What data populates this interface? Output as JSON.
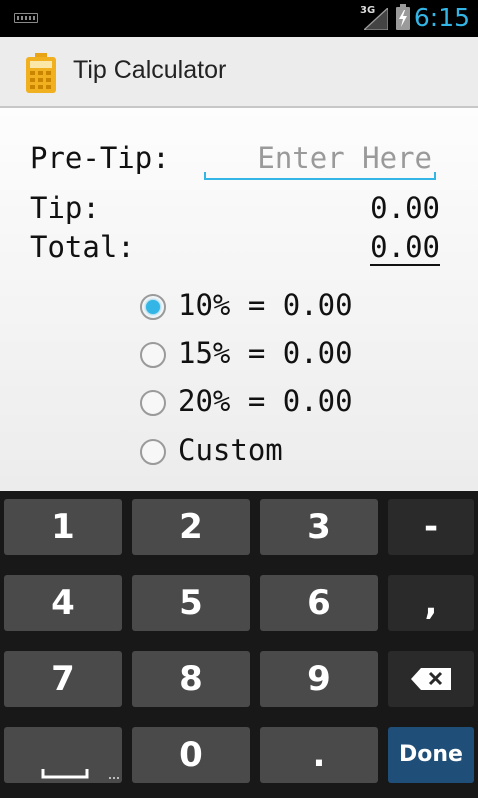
{
  "status_bar": {
    "network": "3G",
    "time": "6:15"
  },
  "app": {
    "title": "Tip Calculator",
    "icon": "calculator-icon",
    "accent_color": "#33b5e5"
  },
  "form": {
    "pretip_label": "Pre-Tip:",
    "pretip_placeholder": "Enter Here",
    "pretip_value": "",
    "tip_label": "Tip:",
    "tip_value": "0.00",
    "total_label": "Total:",
    "total_value": "0.00"
  },
  "tip_options": [
    {
      "label": "10% = 0.00",
      "selected": true
    },
    {
      "label": "15% = 0.00",
      "selected": false
    },
    {
      "label": "20% = 0.00",
      "selected": false
    },
    {
      "label": "Custom",
      "selected": false
    }
  ],
  "keyboard": {
    "keys": [
      "1",
      "2",
      "3",
      "-",
      "4",
      "5",
      "6",
      ",",
      "7",
      "8",
      "9",
      "backspace",
      "space",
      "0",
      ".",
      "Done"
    ],
    "done_label": "Done",
    "done_color": "#1f4e78"
  }
}
